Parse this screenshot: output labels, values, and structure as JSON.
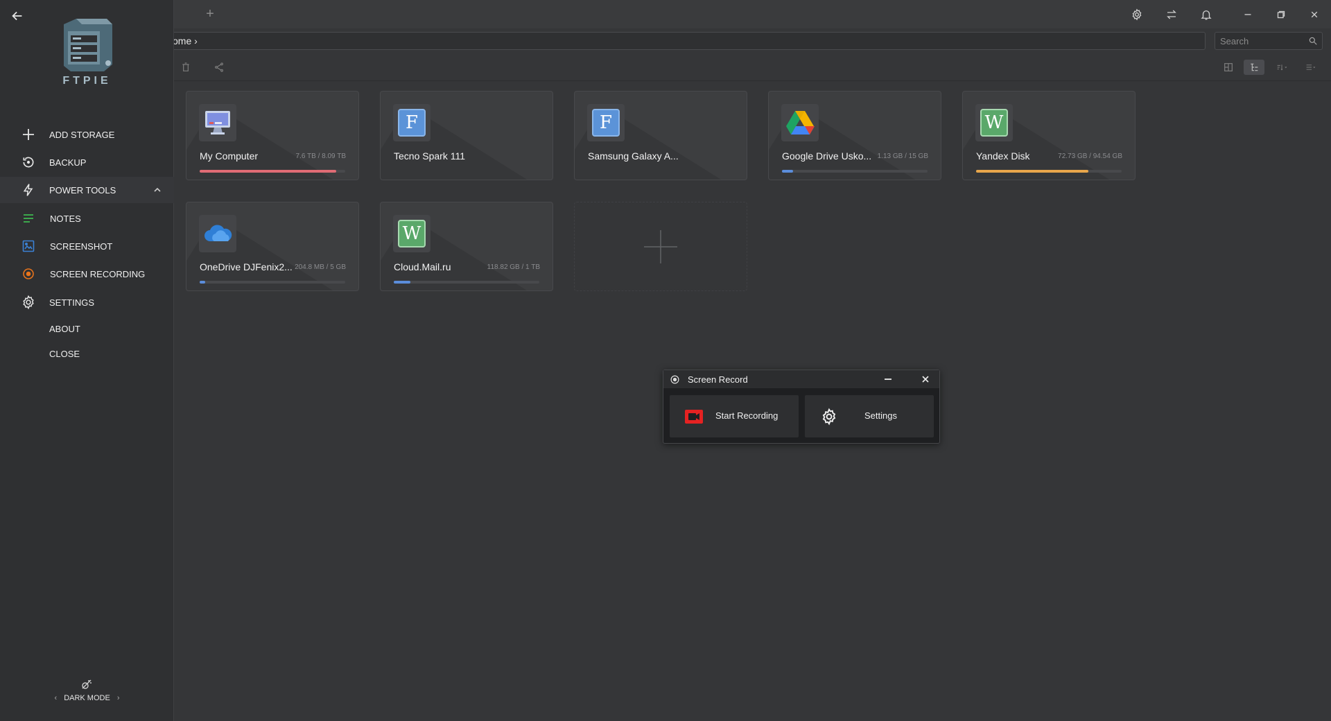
{
  "sidebar": {
    "logo_text": "FTPIE",
    "menu": [
      {
        "label": "ADD STORAGE",
        "icon": "plus-icon"
      },
      {
        "label": "BACKUP",
        "icon": "backup-icon"
      },
      {
        "label": "POWER TOOLS",
        "icon": "lightning-icon",
        "expanded": true
      },
      {
        "label": "NOTES",
        "icon": "notes-icon",
        "color": "#3fb950"
      },
      {
        "label": "SCREENSHOT",
        "icon": "screenshot-icon",
        "color": "#3b82d6"
      },
      {
        "label": "SCREEN RECORDING",
        "icon": "record-icon",
        "color": "#e8741c"
      },
      {
        "label": "SETTINGS",
        "icon": "gear-icon"
      },
      {
        "label": "ABOUT"
      },
      {
        "label": "CLOSE"
      }
    ],
    "dark_mode_label": "DARK MODE"
  },
  "address": {
    "breadcrumb": "ome ›",
    "search_placeholder": "Search"
  },
  "storages": [
    {
      "name": "My Computer",
      "size": "7.6 TB / 8.09 TB",
      "usage": 0.94,
      "bar_color": "#e06c75",
      "icon": "computer-icon"
    },
    {
      "name": "Tecno Spark 111",
      "size": "",
      "usage": null,
      "icon": "ftp-f-icon"
    },
    {
      "name": "Samsung Galaxy A...",
      "size": "",
      "usage": null,
      "icon": "ftp-f-icon"
    },
    {
      "name": "Google Drive Usko...",
      "size": "1.13 GB / 15 GB",
      "usage": 0.075,
      "bar_color": "#5b8ddb",
      "icon": "google-drive-icon"
    },
    {
      "name": "Yandex Disk",
      "size": "72.73 GB / 94.54 GB",
      "usage": 0.77,
      "bar_color": "#e8a64b",
      "icon": "webdav-w-icon"
    },
    {
      "name": "OneDrive DJFenix2...",
      "size": "204.8 MB / 5 GB",
      "usage": 0.04,
      "bar_color": "#5b8ddb",
      "icon": "onedrive-icon"
    },
    {
      "name": "Cloud.Mail.ru",
      "size": "118.82 GB / 1 TB",
      "usage": 0.116,
      "bar_color": "#5b8ddb",
      "icon": "webdav-w-icon"
    }
  ],
  "dialog": {
    "title": "Screen Record",
    "start_label": "Start Recording",
    "settings_label": "Settings"
  },
  "colors": {
    "record_red": "#e52222",
    "ftp_blue": "#5b93d8",
    "webdav_green": "#5aa86a"
  }
}
